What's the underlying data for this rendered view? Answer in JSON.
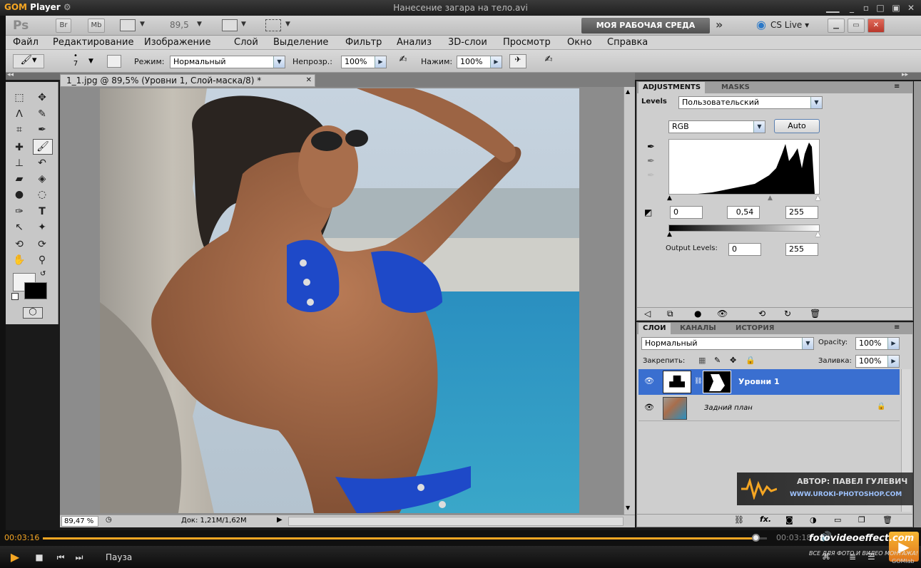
{
  "gom": {
    "logo_a": "GOM",
    "logo_b": " Player",
    "window_title": "Нанесение загара на тело.avi",
    "time_current": "00:03:16",
    "time_total": "00:03:18",
    "status": "Пауза",
    "progress_fraction": 0.985,
    "watermark_site": "fotovideoeffect.com",
    "watermark_tagline": "ВСЕ ДЛЯ ФОТО И ВИДЕО МОНТАЖА!",
    "gomlab": "GOMlab"
  },
  "ps": {
    "logo": "Ps",
    "bridge": "Br",
    "minibridge": "Mb",
    "zoom_value": "89,5",
    "workspace": "МОЯ РАБОЧАЯ СРЕДА",
    "cslive": "CS Live",
    "menu": [
      "Файл",
      "Редактирование",
      "Изображение",
      "Слой",
      "Выделение",
      "Фильтр",
      "Анализ",
      "3D-слои",
      "Просмотр",
      "Окно",
      "Справка"
    ],
    "options": {
      "brush_size": "7",
      "mode_label": "Режим:",
      "mode_value": "Нормальный",
      "opacity_label": "Непрозр.:",
      "opacity_value": "100%",
      "flow_label": "Нажим:",
      "flow_value": "100%"
    },
    "document": {
      "tab_title": "1_1.jpg @ 89,5% (Уровни 1, Слой-маска/8) *",
      "zoom_status": "89,47 %",
      "doc_size": "Док: 1,21M/1,62M"
    },
    "adjustments": {
      "tab_active": "ADJUSTMENTS",
      "tab_inactive": "MASKS",
      "title": "Levels",
      "preset": "Пользовательский",
      "channel": "RGB",
      "auto_label": "Auto",
      "input_black": "0",
      "input_gamma": "0,54",
      "input_white": "255",
      "output_label": "Output Levels:",
      "output_black": "0",
      "output_white": "255"
    },
    "layers": {
      "tabs": [
        "СЛОИ",
        "КАНАЛЫ",
        "ИСТОРИЯ"
      ],
      "blend_mode": "Нормальный",
      "opacity_label": "Opacity:",
      "opacity_value": "100%",
      "lock_label": "Закрепить:",
      "fill_label": "Заливка:",
      "fill_value": "100%",
      "items": [
        {
          "name": "Уровни 1",
          "selected": true
        },
        {
          "name": "Задний план",
          "selected": false
        }
      ]
    },
    "author_watermark": {
      "line1": "АВТОР: ПАВЕЛ ГУЛЕВИЧ",
      "line2": "WWW.UROKI-PHOTOSHOP.COM"
    }
  },
  "colors": {
    "selection_blue": "#3a6fd0",
    "gom_orange": "#f5a623",
    "bikini_blue": "#1e49c8"
  }
}
